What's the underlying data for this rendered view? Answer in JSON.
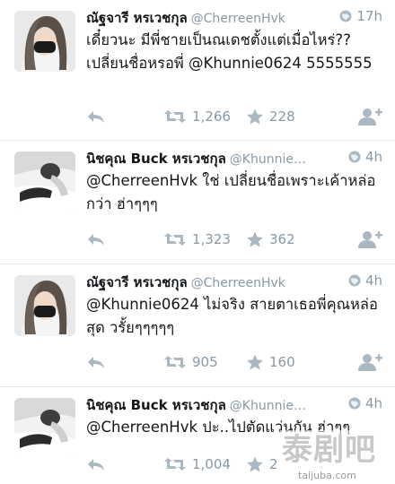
{
  "tweets": [
    {
      "name": "ณัฐจารี หรเวชกุล",
      "handle": "@CherreenHvk",
      "time": "17h",
      "text": "เดี๋ยวนะ มีพี่ชายเป็นณเดชตั้งแต่เมื่อไหร่?? เปลี่ยนชื่อหรอพี่ @Khunnie0624 5555555",
      "retweets": "1,266",
      "likes": "228",
      "avatar_icon": "girl-face-mask-avatar"
    },
    {
      "name": "นิชคุณ Buck หรเวชกุล",
      "handle": "@Khunnie…",
      "time": "4h",
      "text": "@CherreenHvk ใช่ เปลี่ยนชื่อเพราะเค้าหล่อกว่า ฮ่าๆๆๆ",
      "retweets": "1,323",
      "likes": "362",
      "avatar_icon": "man-lying-avatar"
    },
    {
      "name": "ณัฐจารี หรเวชกุล",
      "handle": "@CherreenHvk",
      "time": "4h",
      "text": "@Khunnie0624 ไม่จริง สายตาเธอพี่คุณหล่อสุด วรั้ยๆๆๆๆๆ",
      "retweets": "905",
      "likes": "160",
      "avatar_icon": "girl-face-mask-avatar"
    },
    {
      "name": "นิชคุณ Buck หรเวชกุล",
      "handle": "@Khunnie…",
      "time": "4h",
      "text": "@CherreenHvk ปะ..ไปตัดแว่นกัน ฮ่าๆๆ",
      "retweets": "1,004",
      "likes": "2",
      "avatar_icon": "man-lying-avatar"
    }
  ],
  "watermark": {
    "main": "泰剧吧",
    "sub": "taijuba.com"
  },
  "colors": {
    "text": "#14171a",
    "muted": "#8899a6",
    "divider": "#e1e8ed",
    "icon": "#aab8c2"
  }
}
